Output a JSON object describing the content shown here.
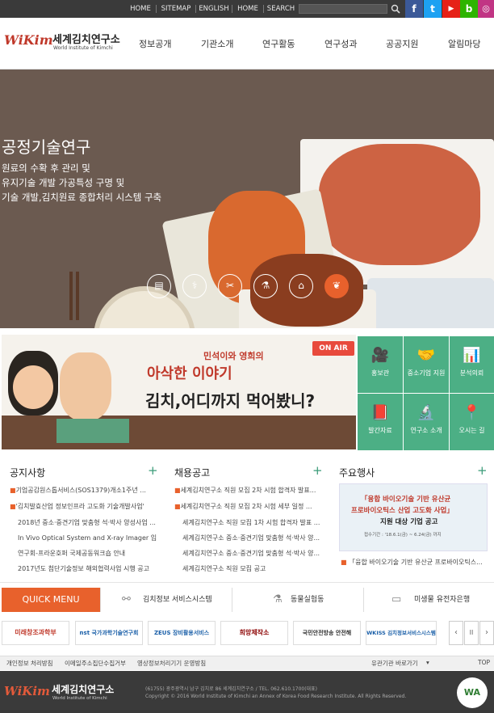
{
  "topnav": {
    "links": [
      "HOME",
      "SITEMAP",
      "ENGLISH",
      "HOME",
      "SEARCH"
    ],
    "social": [
      "f",
      "t",
      "▶",
      "b",
      "◎"
    ]
  },
  "logo": {
    "wi": "WiKim",
    "name_ko": "세계김치연구소",
    "name_en": "World Institute of Kimchi"
  },
  "gnb": [
    "정보공개",
    "기관소개",
    "연구활동",
    "연구성과",
    "공공지원",
    "알림마당"
  ],
  "hero": {
    "title": "공정기술연구",
    "lines": [
      "원료의 수확 후 관리 및",
      "유지기술 개발 가공특성 구명 및",
      "기술 개발,김치원료 종합처리 시스템 구축"
    ]
  },
  "banner": {
    "onair": "ON AIR",
    "small": "민석이와 영희의",
    "big": "아삭한 이야기",
    "slogan": "김치,어디까지 먹어봤니?"
  },
  "quicklinks": [
    {
      "label": "홍보관",
      "icon": "🎥"
    },
    {
      "label": "중소기업 지원",
      "icon": "🤝"
    },
    {
      "label": "분석의뢰",
      "icon": "📊"
    },
    {
      "label": "발간자료",
      "icon": "📕"
    },
    {
      "label": "연구소 소개",
      "icon": "🔬"
    },
    {
      "label": "오시는 길",
      "icon": "📍"
    }
  ],
  "notice": {
    "title": "공지사항",
    "items": [
      "기업공감원스톱서비스(SOS1379)개소1주년 ...",
      "'김치발효산업 정보인프라 고도화 기술개발사업'",
      "2018년 중소·중견기업 맞춤형 석·박사 양성사업 ...",
      "In Vivo Optical System and X-ray Imager 입...",
      "연구회-프라운호퍼 국제공동워크숍 안내",
      "2017년도 첨단기술정보 해외협력사업 시행 공고"
    ]
  },
  "recruit": {
    "title": "채용공고",
    "items": [
      "세계김치연구소 직원 모집 2차 시험 합격자 발표...",
      "세계김치연구소 직원 모집 2차 시험 세부 일정 ...",
      "세계김치연구소 직원 모집 1차 시험 합격자 발표 ...",
      "세계김치연구소 중소·중견기업 맞춤형 석·박사 양...",
      "세계김치연구소 중소·중견기업 맞춤형 석·박사 양...",
      "세계김치연구소 직원 모집 공고"
    ]
  },
  "events": {
    "title": "주요행사",
    "poster_l1": "「융합 바이오기술 기반 유산균",
    "poster_l2": "프로바이오틱스 산업 고도화 사업」",
    "poster_l3": "지원 대상 기업 공고",
    "poster_date": "접수기간 : '18.6.1(금) ~ 6.24(금) 까지",
    "caption": "「융합 바이오기술 기반 유산균 프로바이오틱스..."
  },
  "quickmenu": {
    "label": "QUICK MENU",
    "items": [
      "김치정보 서비스시스템",
      "동물실험동",
      "미생물 유전자은행"
    ]
  },
  "sites": [
    "미래창조과학부",
    "nst 국가과학기술연구회",
    "ZEUS 장비활용서비스",
    "희망제작소",
    "국민안전방송 안전해",
    "WKISS 김치정보서비스시스템"
  ],
  "site_controls": [
    "‹",
    "II",
    "›"
  ],
  "footer": {
    "links": [
      "개인정보 처리방침",
      "이메일주소집단수집거부",
      "영상정보처리기기 운영방침"
    ],
    "related": "유관기관 바로가기",
    "top": "TOP",
    "address": "(61755) 광주광역시 남구 김치로 86 세계김치연구소 / TEL. 062.610.1700(대표)",
    "copyright": "Copyright © 2016 World Institute of Kimchi an Annex of Korea Food Research Institute. All Rights Reserved.",
    "badge": "WA"
  }
}
